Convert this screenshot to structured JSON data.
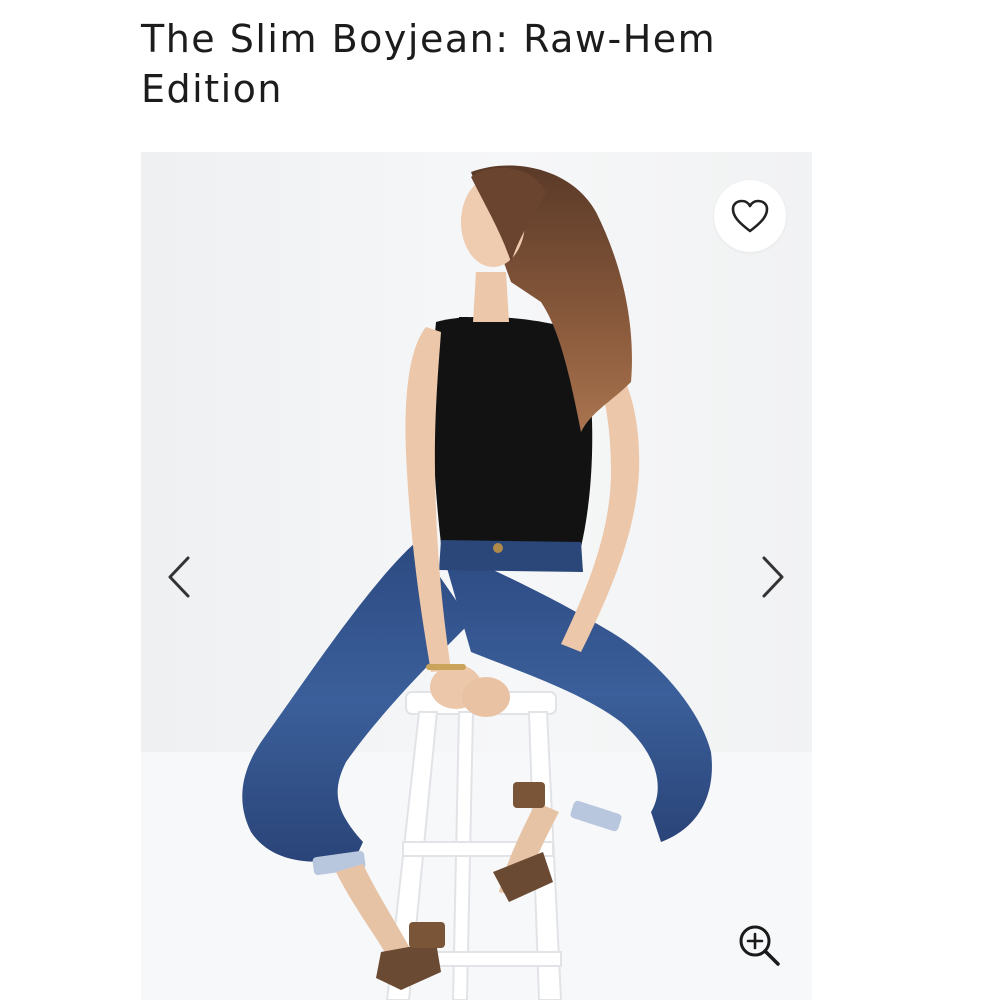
{
  "product": {
    "title": "The Slim Boyjean: Raw-Hem Edition"
  },
  "gallery": {
    "image_alt": "Model wearing The Slim Boyjean sitting on a white stool",
    "favorite_icon": "heart-outline-icon",
    "prev_icon": "chevron-left-icon",
    "next_icon": "chevron-right-icon",
    "zoom_icon": "zoom-in-icon"
  },
  "colors": {
    "text": "#1c1c1c",
    "background": "#ffffff",
    "photo_background": "#f2f3f4",
    "denim": "#2f4f86",
    "top": "#121212"
  }
}
